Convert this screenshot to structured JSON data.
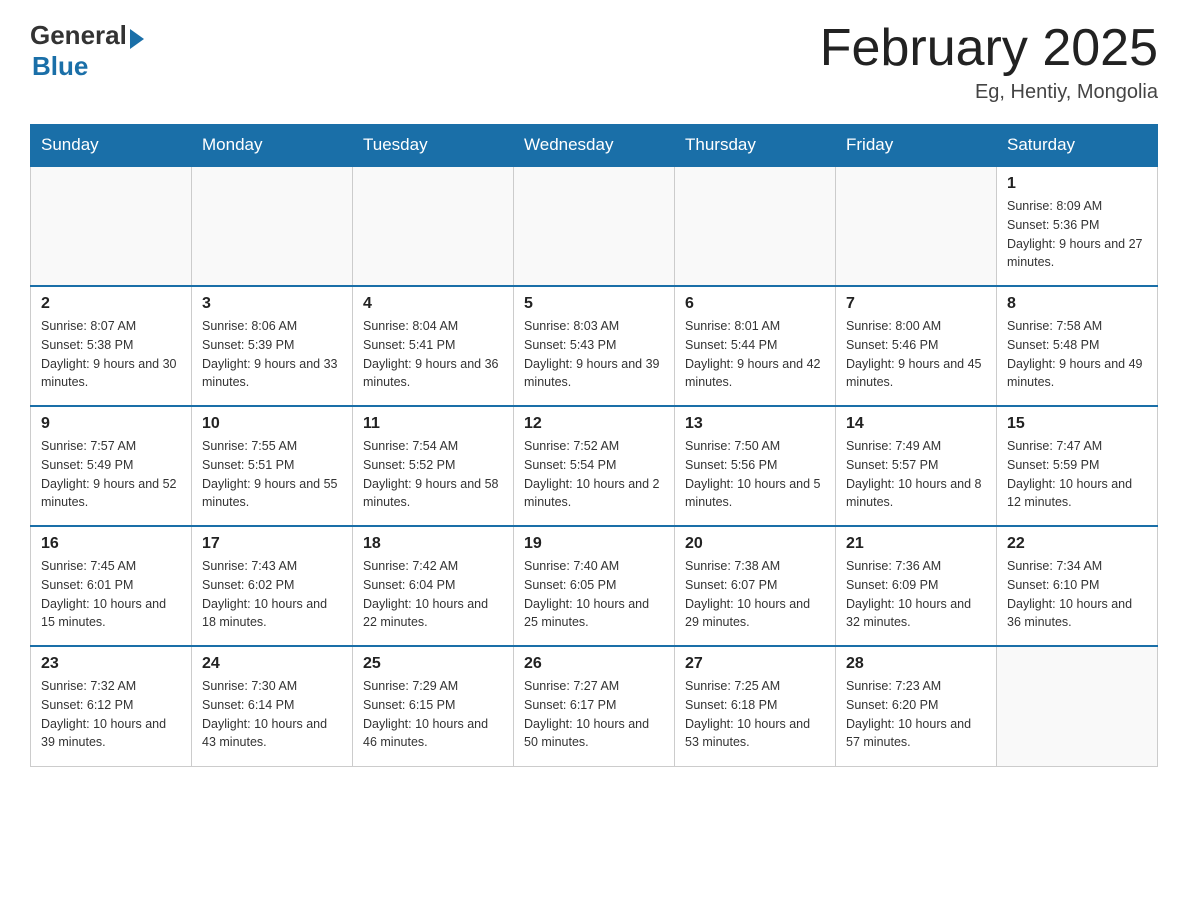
{
  "header": {
    "logo_text_general": "General",
    "logo_text_blue": "Blue",
    "month_title": "February 2025",
    "location": "Eg, Hentiy, Mongolia"
  },
  "calendar": {
    "days_of_week": [
      "Sunday",
      "Monday",
      "Tuesday",
      "Wednesday",
      "Thursday",
      "Friday",
      "Saturday"
    ],
    "weeks": [
      [
        {
          "day": "",
          "info": ""
        },
        {
          "day": "",
          "info": ""
        },
        {
          "day": "",
          "info": ""
        },
        {
          "day": "",
          "info": ""
        },
        {
          "day": "",
          "info": ""
        },
        {
          "day": "",
          "info": ""
        },
        {
          "day": "1",
          "info": "Sunrise: 8:09 AM\nSunset: 5:36 PM\nDaylight: 9 hours and 27 minutes."
        }
      ],
      [
        {
          "day": "2",
          "info": "Sunrise: 8:07 AM\nSunset: 5:38 PM\nDaylight: 9 hours and 30 minutes."
        },
        {
          "day": "3",
          "info": "Sunrise: 8:06 AM\nSunset: 5:39 PM\nDaylight: 9 hours and 33 minutes."
        },
        {
          "day": "4",
          "info": "Sunrise: 8:04 AM\nSunset: 5:41 PM\nDaylight: 9 hours and 36 minutes."
        },
        {
          "day": "5",
          "info": "Sunrise: 8:03 AM\nSunset: 5:43 PM\nDaylight: 9 hours and 39 minutes."
        },
        {
          "day": "6",
          "info": "Sunrise: 8:01 AM\nSunset: 5:44 PM\nDaylight: 9 hours and 42 minutes."
        },
        {
          "day": "7",
          "info": "Sunrise: 8:00 AM\nSunset: 5:46 PM\nDaylight: 9 hours and 45 minutes."
        },
        {
          "day": "8",
          "info": "Sunrise: 7:58 AM\nSunset: 5:48 PM\nDaylight: 9 hours and 49 minutes."
        }
      ],
      [
        {
          "day": "9",
          "info": "Sunrise: 7:57 AM\nSunset: 5:49 PM\nDaylight: 9 hours and 52 minutes."
        },
        {
          "day": "10",
          "info": "Sunrise: 7:55 AM\nSunset: 5:51 PM\nDaylight: 9 hours and 55 minutes."
        },
        {
          "day": "11",
          "info": "Sunrise: 7:54 AM\nSunset: 5:52 PM\nDaylight: 9 hours and 58 minutes."
        },
        {
          "day": "12",
          "info": "Sunrise: 7:52 AM\nSunset: 5:54 PM\nDaylight: 10 hours and 2 minutes."
        },
        {
          "day": "13",
          "info": "Sunrise: 7:50 AM\nSunset: 5:56 PM\nDaylight: 10 hours and 5 minutes."
        },
        {
          "day": "14",
          "info": "Sunrise: 7:49 AM\nSunset: 5:57 PM\nDaylight: 10 hours and 8 minutes."
        },
        {
          "day": "15",
          "info": "Sunrise: 7:47 AM\nSunset: 5:59 PM\nDaylight: 10 hours and 12 minutes."
        }
      ],
      [
        {
          "day": "16",
          "info": "Sunrise: 7:45 AM\nSunset: 6:01 PM\nDaylight: 10 hours and 15 minutes."
        },
        {
          "day": "17",
          "info": "Sunrise: 7:43 AM\nSunset: 6:02 PM\nDaylight: 10 hours and 18 minutes."
        },
        {
          "day": "18",
          "info": "Sunrise: 7:42 AM\nSunset: 6:04 PM\nDaylight: 10 hours and 22 minutes."
        },
        {
          "day": "19",
          "info": "Sunrise: 7:40 AM\nSunset: 6:05 PM\nDaylight: 10 hours and 25 minutes."
        },
        {
          "day": "20",
          "info": "Sunrise: 7:38 AM\nSunset: 6:07 PM\nDaylight: 10 hours and 29 minutes."
        },
        {
          "day": "21",
          "info": "Sunrise: 7:36 AM\nSunset: 6:09 PM\nDaylight: 10 hours and 32 minutes."
        },
        {
          "day": "22",
          "info": "Sunrise: 7:34 AM\nSunset: 6:10 PM\nDaylight: 10 hours and 36 minutes."
        }
      ],
      [
        {
          "day": "23",
          "info": "Sunrise: 7:32 AM\nSunset: 6:12 PM\nDaylight: 10 hours and 39 minutes."
        },
        {
          "day": "24",
          "info": "Sunrise: 7:30 AM\nSunset: 6:14 PM\nDaylight: 10 hours and 43 minutes."
        },
        {
          "day": "25",
          "info": "Sunrise: 7:29 AM\nSunset: 6:15 PM\nDaylight: 10 hours and 46 minutes."
        },
        {
          "day": "26",
          "info": "Sunrise: 7:27 AM\nSunset: 6:17 PM\nDaylight: 10 hours and 50 minutes."
        },
        {
          "day": "27",
          "info": "Sunrise: 7:25 AM\nSunset: 6:18 PM\nDaylight: 10 hours and 53 minutes."
        },
        {
          "day": "28",
          "info": "Sunrise: 7:23 AM\nSunset: 6:20 PM\nDaylight: 10 hours and 57 minutes."
        },
        {
          "day": "",
          "info": ""
        }
      ]
    ]
  }
}
